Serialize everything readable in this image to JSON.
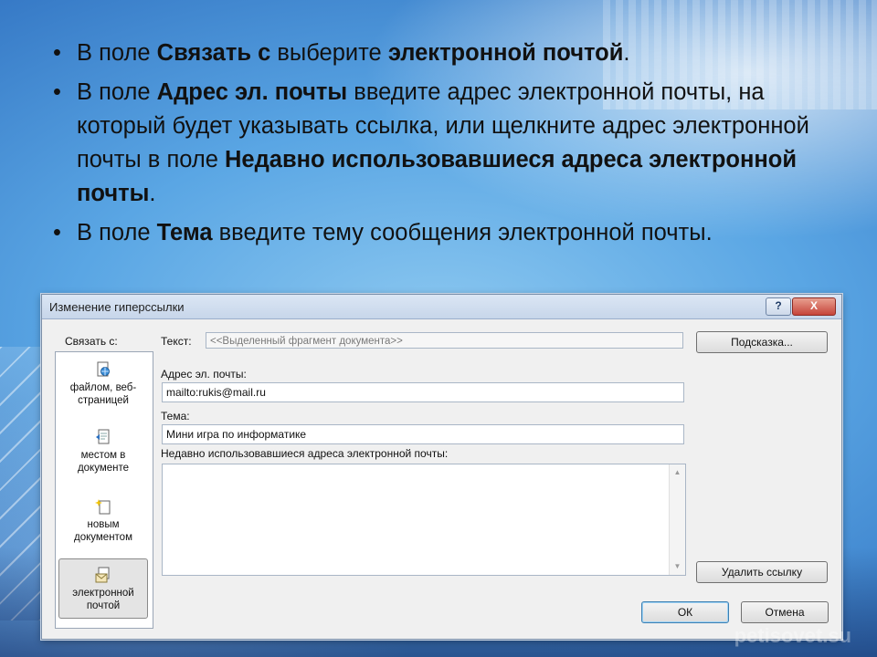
{
  "bullets": [
    {
      "t1": "В поле ",
      "b1": "Связать с",
      "t2": " выберите ",
      "b2": "электронной почтой",
      "t3": "."
    },
    {
      "t1": "В поле ",
      "b1": "Адрес эл. почты",
      "t2": " введите адрес электронной почты, на который будет указывать ссылка, или щелкните адрес электронной почты в поле ",
      "b2": "Недавно использовавшиеся адреса электронной почты",
      "t3": "."
    },
    {
      "t1": "В поле ",
      "b1": "Тема",
      "t2": " введите тему сообщения электронной почты.",
      "b2": "",
      "t3": ""
    }
  ],
  "dialog": {
    "title": "Изменение гиперссылки",
    "help_glyph": "?",
    "close_glyph": "X",
    "link_with_label": "Связать с:",
    "nav": [
      {
        "label": "файлом, веб-страницей",
        "icon": "web-page-icon"
      },
      {
        "label": "местом в документе",
        "icon": "place-in-document-icon"
      },
      {
        "label": "новым документом",
        "icon": "new-document-icon"
      },
      {
        "label": "электронной почтой",
        "icon": "email-icon",
        "selected": true
      }
    ],
    "text_label": "Текст:",
    "text_value": "<<Выделенный фрагмент документа>>",
    "hint_button": "Подсказка...",
    "address_label": "Адрес эл. почты:",
    "address_value": "mailto:rukis@mail.ru",
    "subject_label": "Тема:",
    "subject_value": "Мини игра по информатике",
    "recent_label": "Недавно использовавшиеся адреса электронной почты:",
    "remove_link_button": "Удалить ссылку",
    "ok_button": "ОК",
    "cancel_button": "Отмена"
  },
  "watermark": "petisovet.su",
  "colors": {
    "accent": "#3c7fb1",
    "background": "#5aa6e4"
  }
}
